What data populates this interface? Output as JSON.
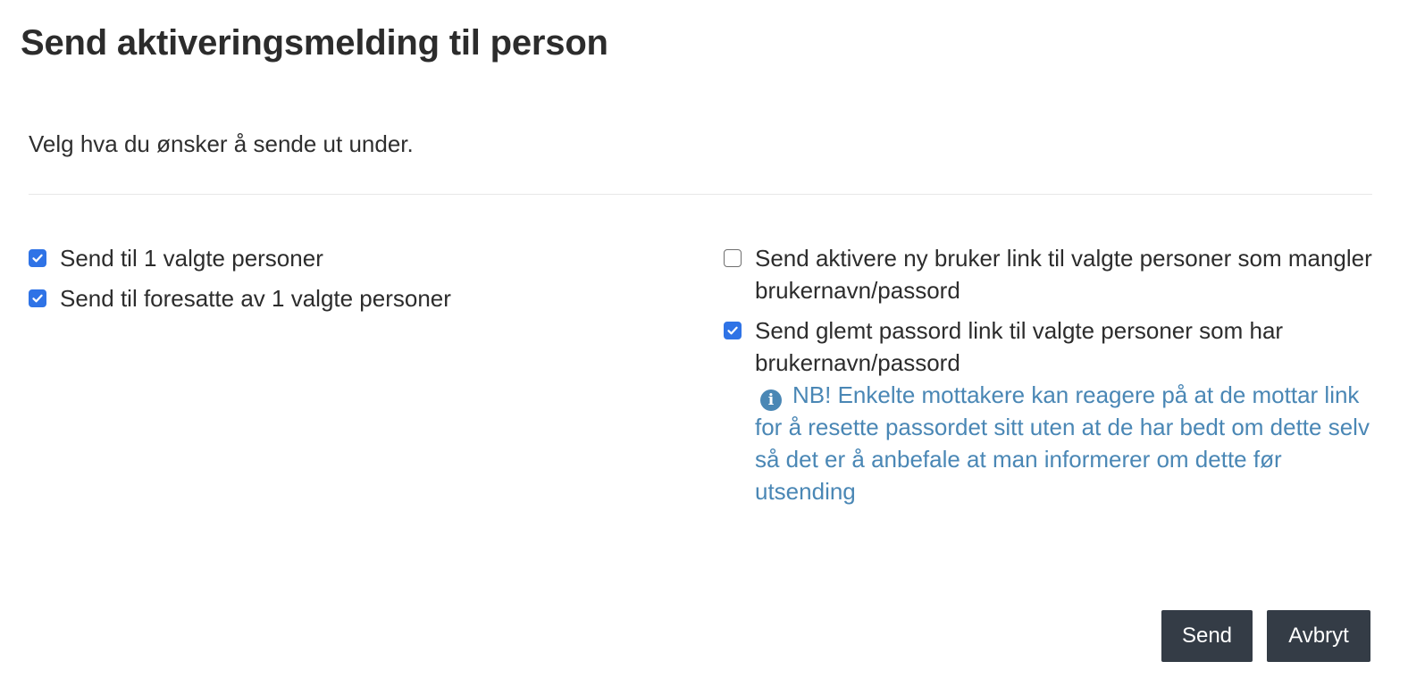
{
  "dialog": {
    "title": "Send aktiveringsmelding til person",
    "intro": "Velg hva du ønsker å sende ut under."
  },
  "options": {
    "left": [
      {
        "label": "Send til 1 valgte personer",
        "checked": true
      },
      {
        "label": "Send til foresatte av 1 valgte personer",
        "checked": true
      }
    ],
    "right": [
      {
        "label": "Send aktivere ny bruker link til valgte personer som mangler brukernavn/passord",
        "checked": false
      },
      {
        "label": "Send glemt passord link til valgte personer som har brukernavn/passord",
        "checked": true
      }
    ]
  },
  "note": {
    "icon": "info-circle-icon",
    "text": "NB! Enkelte mottakere kan reagere på at de mottar link for å resette passordet sitt uten at de har bedt om dette selv så det er å anbefale at man informerer om dette før utsending"
  },
  "buttons": {
    "send": "Send",
    "cancel": "Avbryt"
  },
  "colors": {
    "checkbox_checked": "#2f73e6",
    "note_text": "#4a87b5",
    "button_bg": "#343c46"
  }
}
